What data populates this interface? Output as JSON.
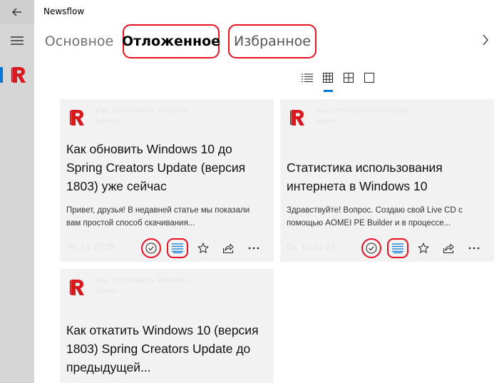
{
  "app": {
    "title": "Newsflow"
  },
  "nav": {
    "back_icon": "back-arrow-icon",
    "menu_icon": "hamburger-menu-icon",
    "feed_logo": "remontcompa-logo-icon"
  },
  "tabs": [
    {
      "label": "Основное",
      "selected": false
    },
    {
      "label": "Отложенное",
      "selected": true
    },
    {
      "label": "Избранное",
      "selected": false
    }
  ],
  "views": [
    {
      "icon": "list-view-icon",
      "selected": true
    },
    {
      "icon": "grid-3-view-icon",
      "selected": false
    },
    {
      "icon": "grid-2-view-icon",
      "selected": false
    },
    {
      "icon": "single-view-icon",
      "selected": false
    }
  ],
  "cards": [
    {
      "source": "Как установить Windows",
      "author": "admin",
      "title": "Как обновить Windows 10 до Spring Creators Update (версия 1803) уже сейчас",
      "snippet": "Привет, друзья! В недавней статье мы показали вам простой способ скачивания...",
      "time": "Пт, 11:21:39"
    },
    {
      "source": "Как установить Windows",
      "author": "admin",
      "title": "Статистика использования интернета в Windows 10",
      "snippet": "Здравствуйте! Вопрос. Создаю свой Live CD с помощью AOMEI PE Builder и в процессе...",
      "time": "Ср, 11:21:37"
    },
    {
      "source": "Как установить Windows",
      "author": "admin",
      "title": "Как откатить Windows 10 (версия 1803) Spring Creators Update до предыдущей..."
    }
  ],
  "colors": {
    "accent": "#0078d7",
    "highlight": "#e81123",
    "logo": "#d71920",
    "rail": "#d6d6d6",
    "card": "#f2f2f2"
  }
}
